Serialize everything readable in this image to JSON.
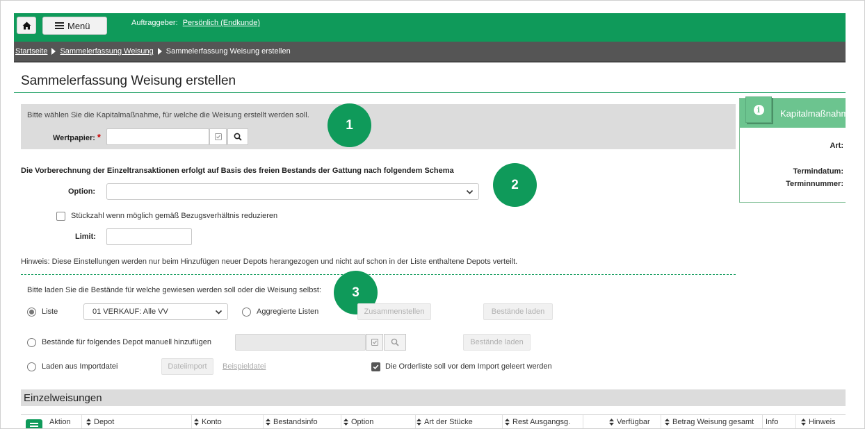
{
  "topbar": {
    "menu_label": "Menü",
    "auftraggeber_label": "Auftraggeber:",
    "auftraggeber_value": "Persönlich (Endkunde)"
  },
  "breadcrumb": [
    "Startseite",
    "Sammelerfassung Weisung",
    "Sammelerfassung Weisung erstellen"
  ],
  "page_title": "Sammelerfassung Weisung erstellen",
  "section1": {
    "instruction": "Bitte wählen Sie die Kapitalmaßnahme, für welche die Weisung erstellt werden soll.",
    "wertpapier_label": "Wertpapier:",
    "required_mark": "*",
    "wertpapier_value": ""
  },
  "badges": [
    "1",
    "2",
    "3"
  ],
  "side_panel": {
    "header": "Kapitalmaßnahme",
    "fields": [
      "Art:",
      "Termindatum:",
      "Terminnummer:"
    ]
  },
  "section2": {
    "title": "Die Vorberechnung der Einzeltransaktionen erfolgt auf Basis des freien Bestands der Gattung nach folgendem Schema",
    "option_label": "Option:",
    "option_value": "",
    "reduce_checkbox_label": "Stückzahl wenn möglich gemäß Bezugsverhältnis reduzieren",
    "reduce_checked": false,
    "limit_label": "Limit:",
    "limit_value": "",
    "hint": "Hinweis: Diese Einstellungen werden nur beim Hinzufügen neuer Depots herangezogen und nicht auf schon in der Liste enthaltene Depots verteilt."
  },
  "section3": {
    "instruction": "Bitte laden Sie die Bestände für welche gewiesen werden soll oder die Weisung selbst:",
    "radio_liste": "Liste",
    "liste_select_value": "01 VERKAUF: Alle VV",
    "radio_aggregiert": "Aggregierte Listen",
    "zusammenstellen_btn": "Zusammenstellen",
    "bestaende_laden_btn": "Bestände laden",
    "radio_depot_manuell": "Bestände für folgendes Depot manuell hinzufügen",
    "depot_input_value": "",
    "radio_importdatei": "Laden aus Importdatei",
    "dateiimport_btn": "Dateiimport",
    "beispieldatei_link": "Beispieldatei",
    "orderliste_checkbox_label": "Die Orderliste soll vor dem Import geleert werden",
    "orderliste_checked": true,
    "selected_radio": "Liste"
  },
  "einzelweisungen": {
    "title": "Einzelweisungen",
    "columns": [
      "Aktion",
      "Depot",
      "Konto",
      "Bestandsinfo",
      "Option",
      "Art der Stücke",
      "Rest Ausgangsg.",
      "Verfügbar",
      "Betrag Weisung gesamt",
      "Info",
      "Hinweis"
    ]
  },
  "colors": {
    "brand_green": "#0f9a5a",
    "breadcrumb_gray": "#555555",
    "panel_green": "#6cc48f"
  },
  "icons": [
    "home-icon",
    "hamburger-menu-icon",
    "clipboard-check-icon",
    "search-icon",
    "chevron-down-icon",
    "info-icon",
    "sort-icon"
  ]
}
